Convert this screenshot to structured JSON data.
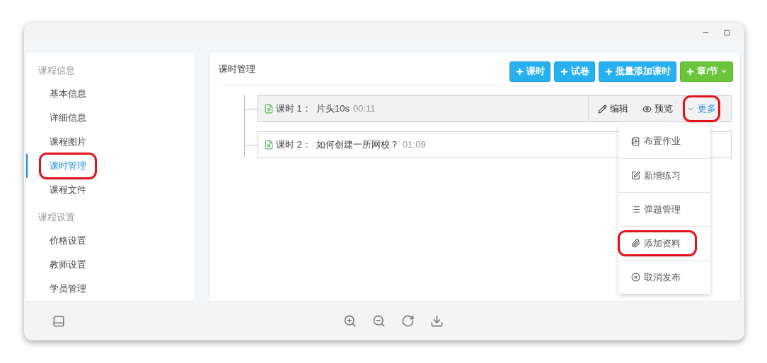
{
  "sidebar": {
    "groups": [
      {
        "title": "课程信息",
        "items": [
          {
            "label": "基本信息",
            "selected": false,
            "highlighted": false
          },
          {
            "label": "详细信息",
            "selected": false,
            "highlighted": false
          },
          {
            "label": "课程图片",
            "selected": false,
            "highlighted": false
          },
          {
            "label": "课时管理",
            "selected": true,
            "highlighted": true
          },
          {
            "label": "课程文件",
            "selected": false,
            "highlighted": false
          }
        ]
      },
      {
        "title": "课程设置",
        "items": [
          {
            "label": "价格设置",
            "selected": false,
            "highlighted": false
          },
          {
            "label": "教师设置",
            "selected": false,
            "highlighted": false
          },
          {
            "label": "学员管理",
            "selected": false,
            "highlighted": false
          }
        ]
      }
    ]
  },
  "main": {
    "title": "课时管理",
    "buttons": [
      {
        "label": "课时",
        "kind": "primary"
      },
      {
        "label": "试卷",
        "kind": "primary"
      },
      {
        "label": "批量添加课时",
        "kind": "primary"
      },
      {
        "label": "章/节",
        "kind": "success"
      }
    ],
    "lessons": [
      {
        "title": "课时 1：  片头10s",
        "duration": "00:11",
        "hovered": true,
        "actions": [
          {
            "label": "编辑",
            "kind": "edit",
            "highlighted": false
          },
          {
            "label": "预览",
            "kind": "preview",
            "highlighted": false
          },
          {
            "label": "更多",
            "kind": "more",
            "highlighted": true
          }
        ]
      },
      {
        "title": "课时 2：  如何创建一所网校？",
        "duration": "01:09",
        "hovered": false
      }
    ],
    "menu": [
      {
        "label": "布置作业",
        "kind": "homework",
        "highlighted": false
      },
      {
        "label": "新增练习",
        "kind": "exercise",
        "highlighted": false
      },
      {
        "label": "弹题管理",
        "kind": "list",
        "highlighted": false
      },
      {
        "label": "添加资料",
        "kind": "attach",
        "highlighted": true
      },
      {
        "label": "取消发布",
        "kind": "unpublish",
        "highlighted": false
      }
    ]
  }
}
